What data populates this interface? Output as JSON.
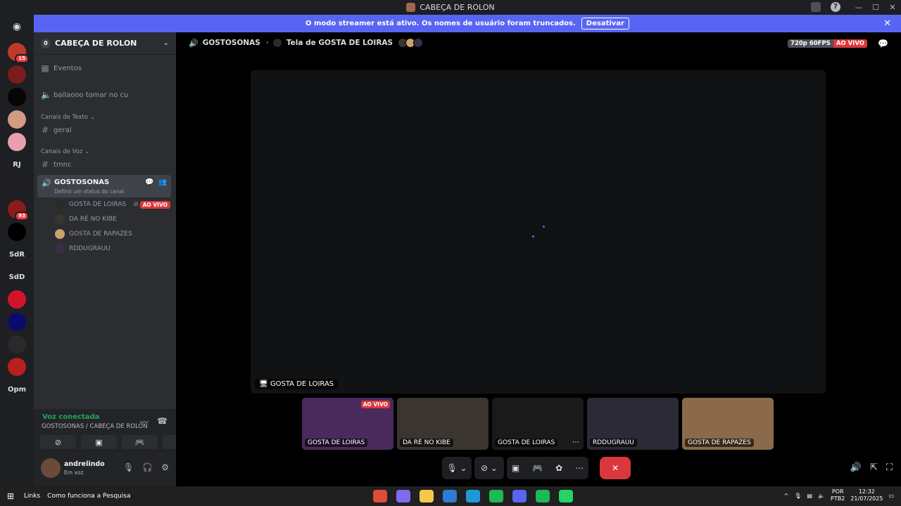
{
  "window": {
    "title": "CABEÇA DE ROLON"
  },
  "banner": {
    "text": "O modo streamer está ativo. Os nomes de usuário foram truncados.",
    "button": "Desativar"
  },
  "guilds": [
    {
      "label": "",
      "badge": "15",
      "color": "#c0392b"
    },
    {
      "label": "",
      "badge": "",
      "color": "#7a1c1c"
    },
    {
      "label": "",
      "badge": "",
      "color": "#050505"
    },
    {
      "label": "",
      "badge": "",
      "color": "#d49a82"
    },
    {
      "label": "",
      "badge": "",
      "color": "#e8a0b0"
    },
    {
      "label": "RJ",
      "badge": "",
      "color": "#1e1f22"
    },
    {
      "label": "",
      "badge": "",
      "color": "#1e1f22"
    },
    {
      "label": "",
      "badge": "93",
      "color": "#8e1b1b"
    },
    {
      "label": "",
      "badge": "",
      "color": "#000000"
    },
    {
      "label": "SdR",
      "badge": "",
      "color": "#1e1f22"
    },
    {
      "label": "SdD",
      "badge": "",
      "color": "#1e1f22"
    },
    {
      "label": "",
      "badge": "",
      "color": "#d1142d"
    },
    {
      "label": "",
      "badge": "",
      "color": "#0b0b6e"
    },
    {
      "label": "",
      "badge": "",
      "color": "#2a2a2a"
    },
    {
      "label": "",
      "badge": "",
      "color": "#b81f1f"
    },
    {
      "label": "Opm",
      "badge": "",
      "color": "#1e1f22"
    }
  ],
  "sidebar": {
    "server_name": "CABEÇA DE ROLON",
    "server_count": "0",
    "events": "Eventos",
    "channel_voice_top": "bailaooo tomar no cu",
    "text_category": "Canais de Texto",
    "text_channel": "geral",
    "voice_category": "Canais de Voz",
    "voice_text_channel": "tmnc",
    "active_channel": {
      "name": "GOSTOSONAS",
      "status": "Definir um status do canal"
    },
    "members": [
      {
        "name": "GOSTA DE LOIRAS",
        "live": "AO VIVO",
        "color": "#2a2a2a"
      },
      {
        "name": "DA RÉ NO KIBE",
        "live": "",
        "color": "#3a3530"
      },
      {
        "name": "GOSTA DE RAPAZES",
        "live": "",
        "color": "#c9a36a"
      },
      {
        "name": "RDDUGRAUU",
        "live": "",
        "color": "#3a2f46"
      }
    ]
  },
  "voice_panel": {
    "status": "Voz conectada",
    "path": "GOSTOSONAS / CABEÇA DE ROLON"
  },
  "user_panel": {
    "name": "andrelindo",
    "status": "Em voz"
  },
  "stage": {
    "channel": "GOSTOSONAS",
    "screen_title": "Tela de GOSTA DE LOIRAS",
    "quality": "720p 60FPS",
    "live": "AO VIVO",
    "screen_label": "GOSTA DE LOIRAS"
  },
  "tiles": [
    {
      "label": "GOSTA DE LOIRAS",
      "live": "AO VIVO",
      "color": "#4a2a5c"
    },
    {
      "label": "DA RÉ NO KIBE",
      "live": "",
      "color": "#3b3530"
    },
    {
      "label": "GOSTA DE LOIRAS",
      "live": "",
      "color": "#1a1a1a"
    },
    {
      "label": "RDDUGRAUU",
      "live": "",
      "color": "#2b2a36"
    },
    {
      "label": "GOSTA DE RAPAZES",
      "live": "",
      "color": "#8a6a4a"
    }
  ],
  "taskbar": {
    "links": "Links",
    "search": "Como funciona a Pesquisa",
    "lang": "POR",
    "layout": "PTB2",
    "time": "12:32",
    "date": "21/07/2025",
    "apps": [
      "#dd4b39",
      "#7c6cf0",
      "#f2c94c",
      "#2d7bd6",
      "#1f9ad6",
      "#1db954",
      "#5865f2",
      "#1db954",
      "#25d366"
    ]
  }
}
